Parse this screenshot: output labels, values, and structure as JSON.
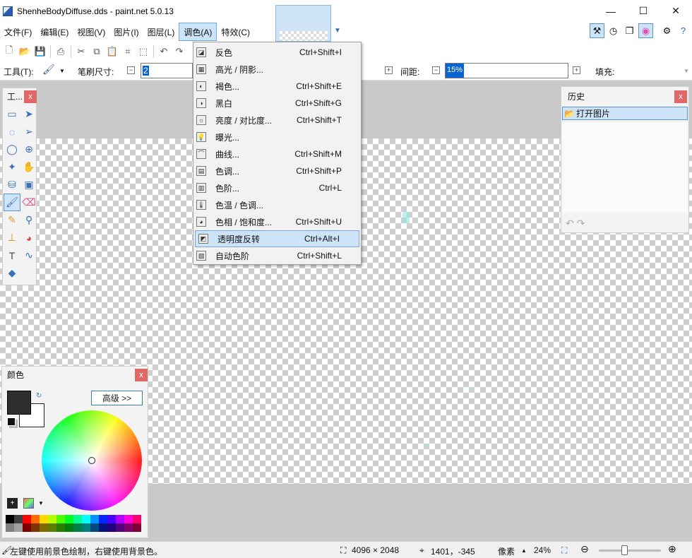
{
  "window": {
    "title": "ShenheBodyDiffuse.dds - paint.net 5.0.13",
    "minimize": "—",
    "maximize": "☐",
    "close": "✕"
  },
  "menubar": {
    "items": [
      "文件(F)",
      "编辑(E)",
      "视图(V)",
      "图片(I)",
      "图层(L)",
      "调色(A)",
      "特效(C)"
    ]
  },
  "toolbar_options": {
    "tool_label": "工具(T):",
    "brush_size_label": "笔刷尺寸:",
    "brush_size_value": "2",
    "spacing_label": "间距:",
    "spacing_value": "15%",
    "fill_label": "填充:"
  },
  "adjust_menu": {
    "items": [
      {
        "icon": "invert-colors-icon",
        "label": "反色",
        "shortcut": "Ctrl+Shift+I"
      },
      {
        "icon": "highlights-shadows-icon",
        "label": "高光 / 阴影...",
        "shortcut": ""
      },
      {
        "icon": "sepia-icon",
        "label": "褐色...",
        "shortcut": "Ctrl+Shift+E"
      },
      {
        "icon": "black-white-icon",
        "label": "黑白",
        "shortcut": "Ctrl+Shift+G"
      },
      {
        "icon": "brightness-contrast-icon",
        "label": "亮度 / 对比度...",
        "shortcut": "Ctrl+Shift+T"
      },
      {
        "icon": "exposure-icon",
        "label": "曝光...",
        "shortcut": ""
      },
      {
        "icon": "curves-icon",
        "label": "曲线...",
        "shortcut": "Ctrl+Shift+M"
      },
      {
        "icon": "posterize-icon",
        "label": "色调...",
        "shortcut": "Ctrl+Shift+P"
      },
      {
        "icon": "levels-icon",
        "label": "色阶...",
        "shortcut": "Ctrl+L"
      },
      {
        "icon": "temperature-icon",
        "label": "色温 / 色调...",
        "shortcut": ""
      },
      {
        "icon": "hue-saturation-icon",
        "label": "色相 / 饱和度...",
        "shortcut": "Ctrl+Shift+U"
      },
      {
        "icon": "invert-alpha-icon",
        "label": "透明度反转",
        "shortcut": "Ctrl+Alt+I"
      },
      {
        "icon": "auto-level-icon",
        "label": "自动色阶",
        "shortcut": "Ctrl+Shift+L"
      }
    ],
    "highlighted_index": 11
  },
  "tools_panel": {
    "title": "工..."
  },
  "history_panel": {
    "title": "历史",
    "entries": [
      "打开图片"
    ]
  },
  "colors_panel": {
    "title": "颜色",
    "advanced_button": "高级 >>",
    "primary_color": "#2e2e2e",
    "secondary_color": "#ffffff",
    "palette": [
      "#000000",
      "#404040",
      "#ff0000",
      "#ff6a00",
      "#ffd800",
      "#b6ff00",
      "#4cff00",
      "#00ff21",
      "#00ff90",
      "#00ffff",
      "#0094ff",
      "#0026ff",
      "#4800ff",
      "#b200ff",
      "#ff00dc",
      "#ff006e",
      "#808080",
      "#a0a0a0",
      "#7f0000",
      "#7f3300",
      "#7f6a00",
      "#5b7f00",
      "#267f00",
      "#007f0e",
      "#007f46",
      "#007f7f",
      "#004a7f",
      "#00137f",
      "#21007f",
      "#57007f",
      "#7f006e",
      "#7f0037"
    ]
  },
  "statusbar": {
    "hint": "左键使用前景色绘制，右键使用背景色。",
    "image_size": "4096 × 2048",
    "cursor_pos": "1401，-345",
    "units": "像素",
    "zoom": "24%"
  },
  "colors": {
    "accent": "#5b95d1",
    "highlight": "#cde3f7",
    "close_red": "#e06868"
  }
}
